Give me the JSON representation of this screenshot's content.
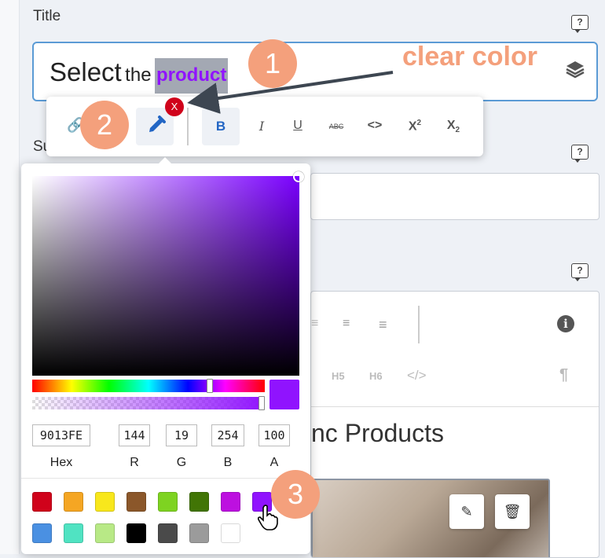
{
  "fields": {
    "title_label": "Title",
    "subtitle_label_partial": "Su",
    "help_glyph": "?"
  },
  "title_input": {
    "word1": "Select",
    "word2": "the",
    "word3": "product",
    "highlight_color": "#9013fe",
    "layers_icon": "layers-icon"
  },
  "toolbar": {
    "link_icon": "🔗",
    "color_icon": "✒",
    "clear_badge": "X",
    "bold": "B",
    "italic": "I",
    "underline": "U",
    "strike": "ABC",
    "code": "<>",
    "superscript_base": "X",
    "superscript_exp": "2",
    "subscript_base": "X",
    "subscript_exp": "2"
  },
  "editor": {
    "h5": "H5",
    "h6": "H6",
    "code_view": "</>",
    "paragraph": "¶",
    "info": "i",
    "heading_partial": "nc Products",
    "edit_icon": "✎",
    "trash_icon": "🗑"
  },
  "color_picker": {
    "current_color": "#9013fe",
    "hex": "9013FE",
    "r": "144",
    "g": "19",
    "b": "254",
    "a": "100",
    "hex_label": "Hex",
    "r_label": "R",
    "g_label": "G",
    "b_label": "B",
    "a_label": "A",
    "hue_position": 0.76,
    "alpha_position": 1.0,
    "swatches": [
      "#d0021b",
      "#f5a623",
      "#f8e71c",
      "#8b572a",
      "#7ed321",
      "#417505",
      "#bd10e0",
      "#9013fe",
      "#4a90e2",
      "#50e3c2",
      "#b8e986",
      "#000000",
      "#4a4a4a",
      "#9b9b9b",
      "#ffffff"
    ]
  },
  "annotations": {
    "step1": "1",
    "step2": "2",
    "step3": "3",
    "callout": "clear color"
  }
}
